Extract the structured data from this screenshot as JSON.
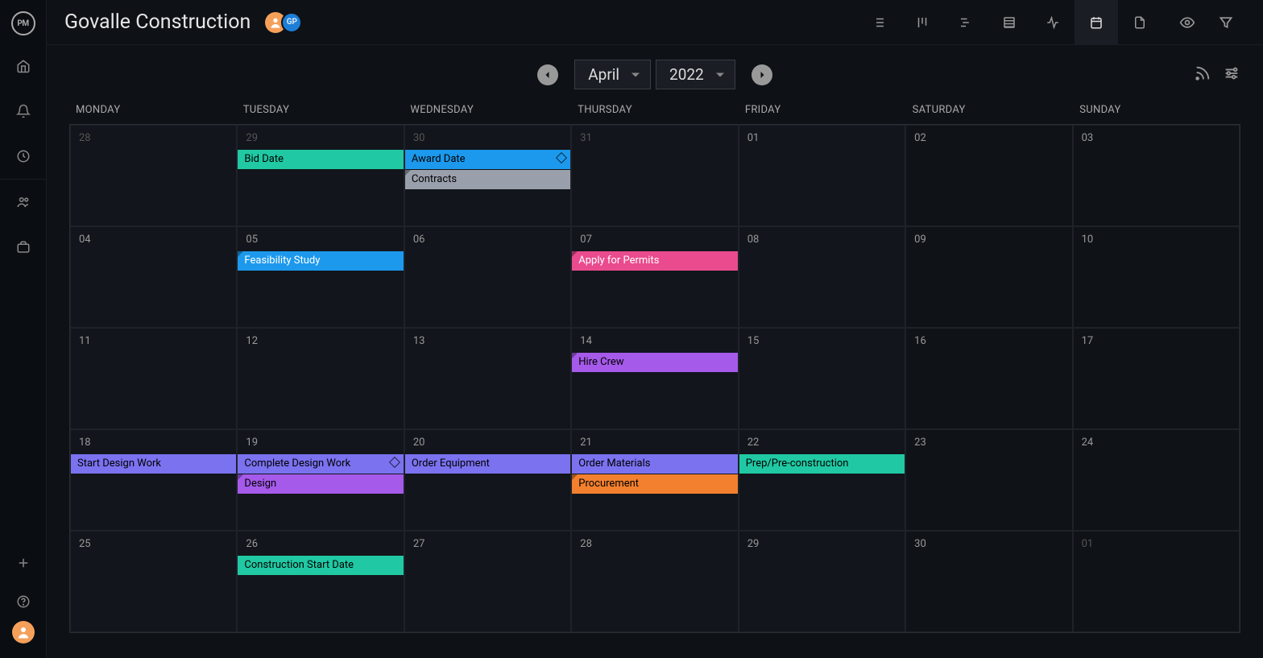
{
  "header": {
    "logoText": "PM",
    "projectTitle": "Govalle Construction",
    "avatars": [
      {
        "type": "person"
      },
      {
        "type": "initials",
        "text": "GP"
      }
    ],
    "viewIcons": [
      "list",
      "board",
      "gantt",
      "sheet",
      "activity",
      "calendar",
      "files"
    ],
    "activeView": "calendar",
    "rightIcons": [
      "eye",
      "filter"
    ]
  },
  "controls": {
    "month": "April",
    "year": "2022"
  },
  "weekdays": [
    "MONDAY",
    "TUESDAY",
    "WEDNESDAY",
    "THURSDAY",
    "FRIDAY",
    "SATURDAY",
    "SUNDAY"
  ],
  "cells": [
    {
      "num": "28",
      "other": true,
      "wknd": false,
      "events": []
    },
    {
      "num": "29",
      "other": true,
      "wknd": false,
      "events": [
        {
          "label": "Bid Date",
          "color": "c-teal"
        }
      ]
    },
    {
      "num": "30",
      "other": true,
      "wknd": false,
      "events": [
        {
          "label": "Award Date",
          "color": "c-blue",
          "diamond": true
        },
        {
          "label": "Contracts",
          "color": "c-gray",
          "corner": true
        }
      ]
    },
    {
      "num": "31",
      "other": true,
      "wknd": false,
      "events": []
    },
    {
      "num": "01",
      "other": false,
      "wknd": false,
      "events": []
    },
    {
      "num": "02",
      "other": false,
      "wknd": true,
      "events": []
    },
    {
      "num": "03",
      "other": false,
      "wknd": true,
      "events": []
    },
    {
      "num": "04",
      "other": false,
      "wknd": false,
      "events": []
    },
    {
      "num": "05",
      "other": false,
      "wknd": false,
      "events": [
        {
          "label": "Feasibility Study",
          "color": "c-blue2",
          "corner": true
        }
      ]
    },
    {
      "num": "06",
      "other": false,
      "wknd": false,
      "events": []
    },
    {
      "num": "07",
      "other": false,
      "wknd": false,
      "events": [
        {
          "label": "Apply for Permits",
          "color": "c-pink",
          "corner": true
        }
      ]
    },
    {
      "num": "08",
      "other": false,
      "wknd": false,
      "events": []
    },
    {
      "num": "09",
      "other": false,
      "wknd": true,
      "events": []
    },
    {
      "num": "10",
      "other": false,
      "wknd": true,
      "events": []
    },
    {
      "num": "11",
      "other": false,
      "wknd": false,
      "events": []
    },
    {
      "num": "12",
      "other": false,
      "wknd": false,
      "events": []
    },
    {
      "num": "13",
      "other": false,
      "wknd": false,
      "events": []
    },
    {
      "num": "14",
      "other": false,
      "wknd": false,
      "events": [
        {
          "label": "Hire Crew",
          "color": "c-purple",
          "corner": true
        }
      ]
    },
    {
      "num": "15",
      "other": false,
      "wknd": false,
      "events": []
    },
    {
      "num": "16",
      "other": false,
      "wknd": true,
      "events": []
    },
    {
      "num": "17",
      "other": false,
      "wknd": true,
      "events": []
    },
    {
      "num": "18",
      "other": false,
      "wknd": false,
      "events": [
        {
          "label": "Start Design Work",
          "color": "c-lav"
        }
      ]
    },
    {
      "num": "19",
      "other": false,
      "wknd": false,
      "events": [
        {
          "label": "Complete Design Work",
          "color": "c-lav",
          "diamond": true
        },
        {
          "label": "Design",
          "color": "c-purple",
          "corner": true
        }
      ]
    },
    {
      "num": "20",
      "other": false,
      "wknd": false,
      "events": [
        {
          "label": "Order Equipment",
          "color": "c-lav"
        }
      ]
    },
    {
      "num": "21",
      "other": false,
      "wknd": false,
      "events": [
        {
          "label": "Order Materials",
          "color": "c-lav"
        },
        {
          "label": "Procurement",
          "color": "c-orange",
          "corner": true
        }
      ]
    },
    {
      "num": "22",
      "other": false,
      "wknd": false,
      "events": [
        {
          "label": "Prep/Pre-construction",
          "color": "c-teal2"
        }
      ]
    },
    {
      "num": "23",
      "other": false,
      "wknd": true,
      "events": []
    },
    {
      "num": "24",
      "other": false,
      "wknd": true,
      "events": []
    },
    {
      "num": "25",
      "other": false,
      "wknd": false,
      "events": []
    },
    {
      "num": "26",
      "other": false,
      "wknd": false,
      "events": [
        {
          "label": "Construction Start Date",
          "color": "c-teal"
        }
      ]
    },
    {
      "num": "27",
      "other": false,
      "wknd": false,
      "events": []
    },
    {
      "num": "28",
      "other": false,
      "wknd": false,
      "events": []
    },
    {
      "num": "29",
      "other": false,
      "wknd": false,
      "events": []
    },
    {
      "num": "30",
      "other": false,
      "wknd": true,
      "events": []
    },
    {
      "num": "01",
      "other": true,
      "wknd": true,
      "events": []
    }
  ]
}
